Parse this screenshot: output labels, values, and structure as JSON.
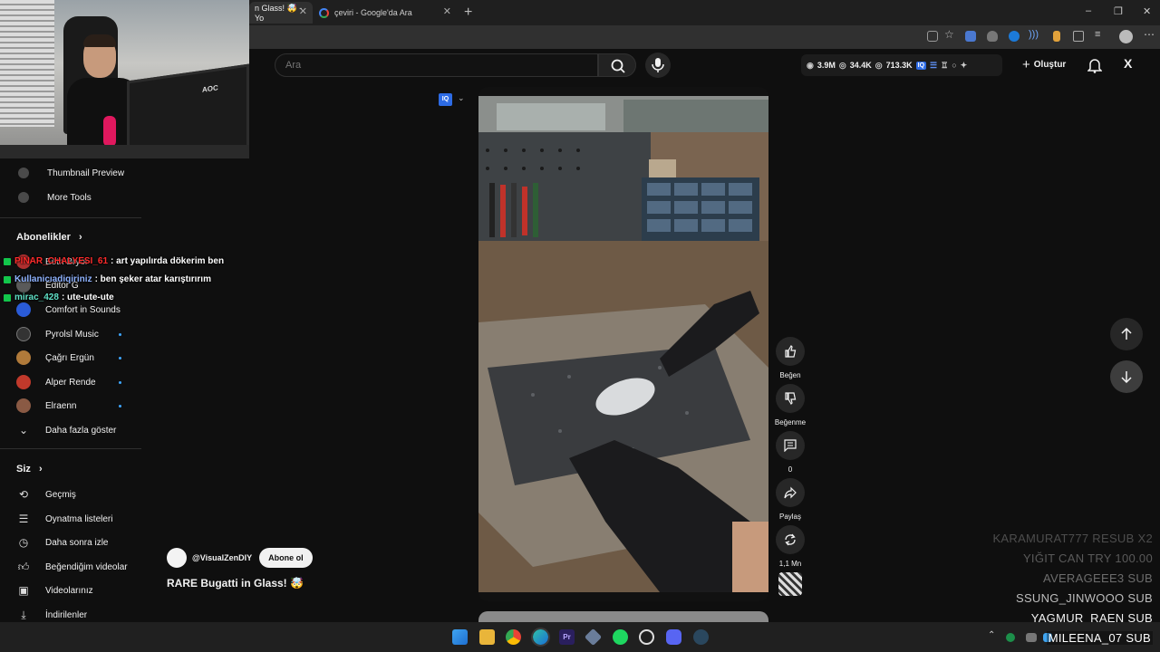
{
  "browser": {
    "tabs": [
      {
        "title": "n Glass! 🤯 - Yo",
        "active": true
      },
      {
        "title": "çeviri - Google'da Ara",
        "active": false
      }
    ],
    "new_tab": "+",
    "window_controls": [
      "–",
      "❐",
      "✕"
    ]
  },
  "header": {
    "search_placeholder": "Ara",
    "stats": {
      "views": "3.9M",
      "watching": "34.4K",
      "followers": "713.3K",
      "iq_label": "IQ"
    },
    "create_label": "Oluştur",
    "close_label": "X"
  },
  "sidebar": {
    "tools": [
      {
        "label": "Thumbnail Preview"
      },
      {
        "label": "More Tools"
      }
    ],
    "subscriptions_title": "Abonelikler",
    "subscriptions": [
      {
        "label": "Eeth Bryor",
        "color": "#b03030",
        "dot": false
      },
      {
        "label": "Editor G",
        "color": "#5a5a5a",
        "dot": false
      },
      {
        "label": "Comfort in Sounds",
        "color": "#2a5bd7",
        "dot": false
      },
      {
        "label": "Pyrolsl Music",
        "color": "#333333",
        "dot": true
      },
      {
        "label": "Çağrı Ergün",
        "color": "#b07a3a",
        "dot": true
      },
      {
        "label": "Alper Rende",
        "color": "#c0392b",
        "dot": true
      },
      {
        "label": "Elraenn",
        "color": "#8a5a44",
        "dot": true
      }
    ],
    "show_more": "Daha fazla göster",
    "you_title": "Siz",
    "you_items": [
      {
        "label": "Geçmiş",
        "icon": "history-icon"
      },
      {
        "label": "Oynatma listeleri",
        "icon": "playlist-icon"
      },
      {
        "label": "Daha sonra izle",
        "icon": "clock-icon"
      },
      {
        "label": "Beğendiğim videolar",
        "icon": "thumbs-up-icon"
      },
      {
        "label": "Videolarınız",
        "icon": "video-icon"
      },
      {
        "label": "İndirilenler",
        "icon": "download-icon"
      }
    ]
  },
  "chat": [
    {
      "user": "PINAR_CHALYESI_61",
      "user_color": "#ff2b2b",
      "message": ": art yapılırda dökerim ben"
    },
    {
      "user": "Kullanicıadiqiriniz",
      "user_color": "#8fb3ff",
      "message": ": ben şeker atar karıştırırım"
    },
    {
      "user": "mirac_428",
      "user_color": "#5fe0c6",
      "message": ": ute-ute-ute"
    }
  ],
  "short": {
    "channel": "@VisualZenDIY",
    "subscribe": "Abone ol",
    "title": "RARE Bugatti in Glass! 🤯",
    "actions": {
      "like": "Beğen",
      "dislike": "Beğenme",
      "comments": "0",
      "share": "Paylaş",
      "remix": "1,1 Mn"
    }
  },
  "alerts": [
    {
      "text": "KARAMURAT777  RESUB X2",
      "color": "#4d4d4d"
    },
    {
      "text": "YIĞIT CAN  TRY 100.00",
      "color": "#5a5a5a"
    },
    {
      "text": "AVERAGEEE3  SUB",
      "color": "#6d6d6d"
    },
    {
      "text": "SSUNG_JINWOOO  SUB",
      "color": "#bdbdbd"
    },
    {
      "text": "YAGMUR_RAEN  SUB",
      "color": "#f2f2f2"
    },
    {
      "text": "MILEENA_07  SUB",
      "color": "#ffffff"
    }
  ],
  "colors": {
    "accent_blue": "#3ea6ff",
    "iq_blue": "#2d6be4",
    "chat_badge": "#12c64b"
  }
}
